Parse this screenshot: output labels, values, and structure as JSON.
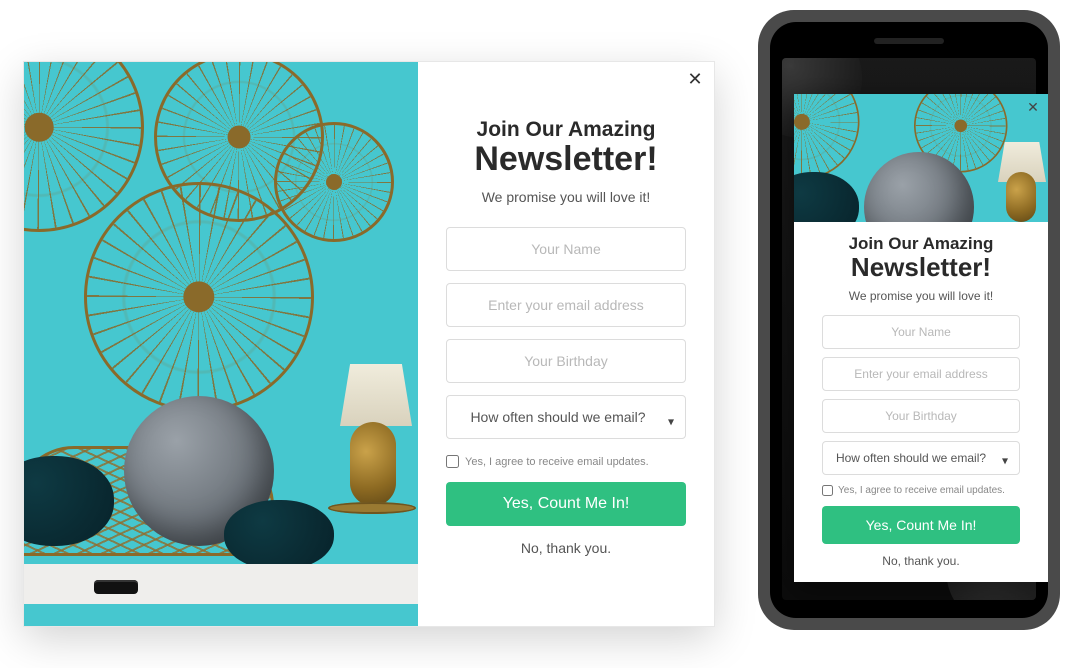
{
  "popup": {
    "title_line1": "Join Our Amazing",
    "title_line2": "Newsletter!",
    "subtitle": "We promise you will love it!",
    "name_placeholder": "Your Name",
    "email_placeholder": "Enter your email address",
    "birthday_placeholder": "Your Birthday",
    "frequency_placeholder": "How often should we email?",
    "agree_label": "Yes, I agree to receive email updates.",
    "cta_label": "Yes, Count Me In!",
    "decline_label": "No, thank you.",
    "close_glyph": "✕"
  },
  "colors": {
    "cta": "#2fc081",
    "photo_bg": "#46c7cf"
  }
}
